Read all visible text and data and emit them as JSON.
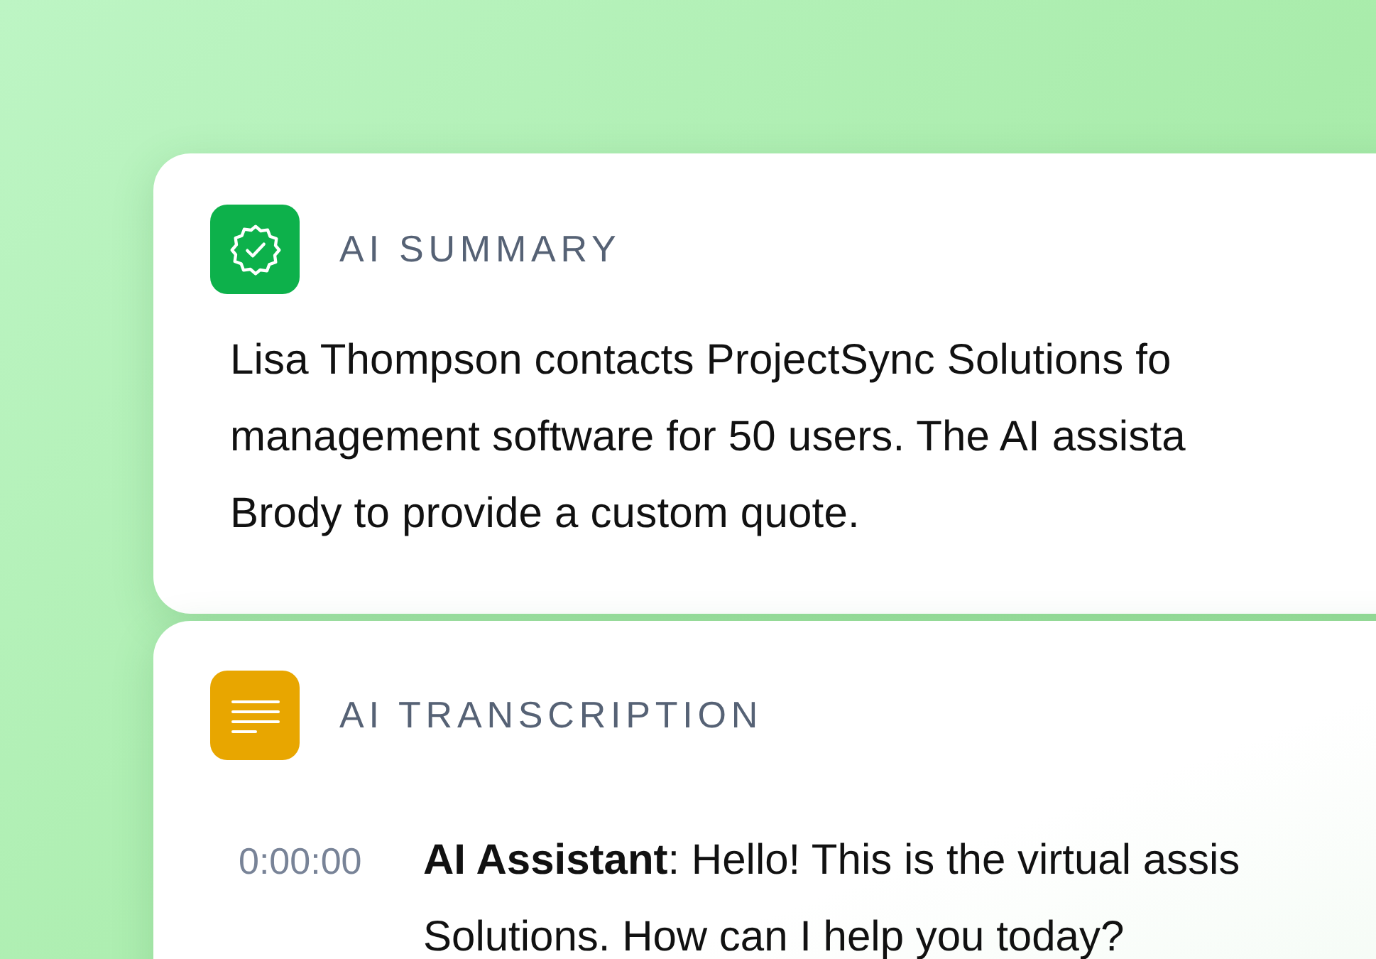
{
  "summary": {
    "label": "AI SUMMARY",
    "lines": [
      "Lisa Thompson contacts ProjectSync Solutions fo",
      "management software for 50 users. The AI assista",
      "Brody to provide a custom quote."
    ]
  },
  "transcription": {
    "label": "AI TRANSCRIPTION",
    "entries": [
      {
        "time": "0:00:00",
        "lines": [
          "**AI Assistant**: Hello! This is the virtual assis",
          "Solutions. How can I help you today?"
        ]
      }
    ]
  }
}
